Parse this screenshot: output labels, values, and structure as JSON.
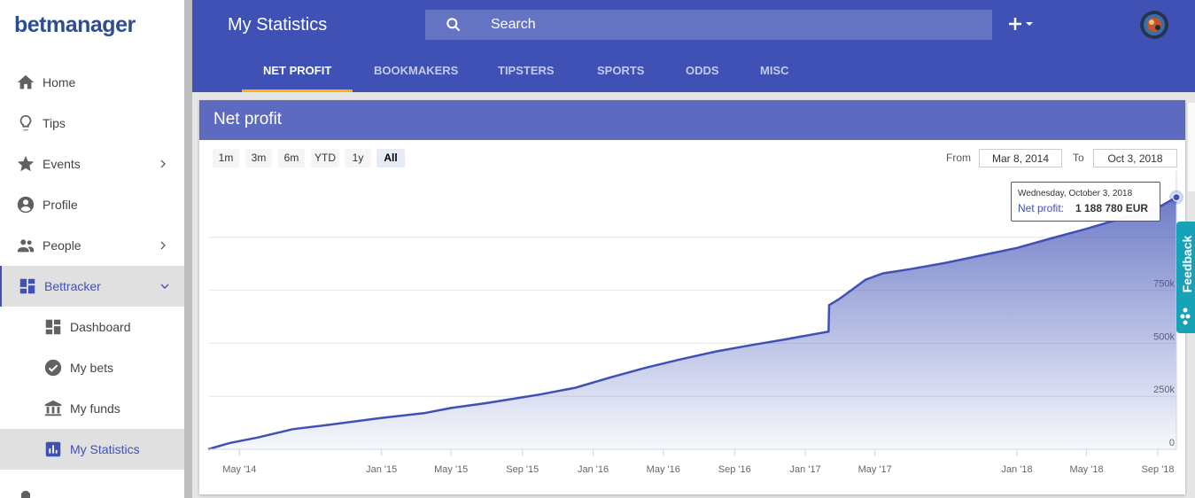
{
  "sidebar": {
    "logo": "betmanager",
    "items": [
      {
        "label": "Home"
      },
      {
        "label": "Tips"
      },
      {
        "label": "Events"
      },
      {
        "label": "Profile"
      },
      {
        "label": "People"
      },
      {
        "label": "Bettracker"
      },
      {
        "label": "Dashboard"
      },
      {
        "label": "My bets"
      },
      {
        "label": "My funds"
      },
      {
        "label": "My Statistics"
      }
    ]
  },
  "header": {
    "title": "My Statistics",
    "search_placeholder": "Search",
    "tabs": [
      "NET PROFIT",
      "BOOKMAKERS",
      "TIPSTERS",
      "SPORTS",
      "ODDS",
      "MISC"
    ],
    "active_tab": "NET PROFIT"
  },
  "panel": {
    "title": "Net profit",
    "ranges": [
      "1m",
      "3m",
      "6m",
      "YTD",
      "1y",
      "All"
    ],
    "selected_range": "All",
    "from_label": "From",
    "from_value": "Mar 8, 2014",
    "to_label": "To",
    "to_value": "Oct 3, 2018"
  },
  "tooltip": {
    "date": "Wednesday, October 3, 2018",
    "series": "Net profit:",
    "value": "1 188 780 EUR"
  },
  "feedback": {
    "label": "Feedback"
  },
  "chart_data": {
    "type": "area",
    "x": [
      "2014-03-08",
      "2014-04-15",
      "2014-06-01",
      "2014-08-01",
      "2014-10-01",
      "2015-01-01",
      "2015-03-15",
      "2015-05-01",
      "2015-07-01",
      "2015-09-01",
      "2015-09-30",
      "2015-12-01",
      "2016-02-01",
      "2016-04-01",
      "2016-06-01",
      "2016-08-01",
      "2016-10-01",
      "2016-12-01",
      "2017-02-10",
      "2017-02-11",
      "2017-03-01",
      "2017-04-15",
      "2017-05-15",
      "2017-07-01",
      "2017-09-01",
      "2017-11-01",
      "2018-01-01",
      "2018-03-01",
      "2018-05-01",
      "2018-07-01",
      "2018-09-01",
      "2018-10-03"
    ],
    "values": [
      0,
      30000,
      55000,
      95000,
      115000,
      148000,
      170000,
      195000,
      218000,
      245000,
      258000,
      290000,
      340000,
      385000,
      425000,
      462000,
      492000,
      520000,
      555000,
      680000,
      710000,
      800000,
      830000,
      850000,
      880000,
      915000,
      950000,
      995000,
      1040000,
      1090000,
      1140000,
      1188780
    ],
    "y_ticks": [
      "0",
      "250k",
      "500k",
      "750k"
    ],
    "x_ticks": [
      "May '14",
      "Jan '15",
      "May '15",
      "Sep '15",
      "Jan '16",
      "May '16",
      "Sep '16",
      "Jan '17",
      "May '17",
      "Jan '18",
      "May '18",
      "Sep '18"
    ],
    "ylim": [
      0,
      1250000
    ],
    "grid": true,
    "legend": "none",
    "color": "#3f51b5"
  }
}
